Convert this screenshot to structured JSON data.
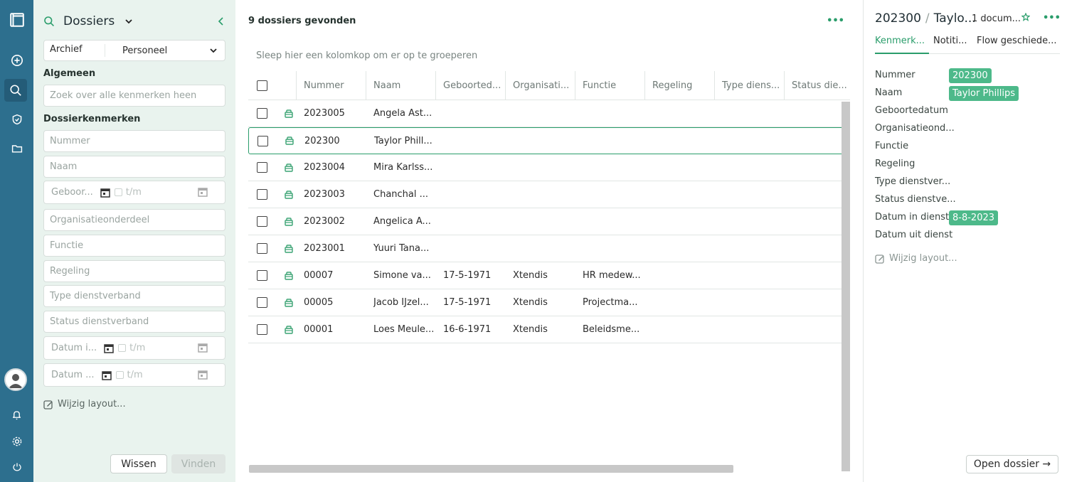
{
  "rail": {
    "icons": [
      "layout-icon",
      "add-icon",
      "search-icon",
      "shield-icon",
      "folder-icon",
      "avatar",
      "bell-icon",
      "gear-icon",
      "power-icon"
    ]
  },
  "search": {
    "title": "Dossiers",
    "archief_label": "Archief",
    "archief_value": "Personeel",
    "section_general": "Algemeen",
    "search_all_placeholder": "Zoek over alle kenmerken heen",
    "section_dossier": "Dossierkenmerken",
    "fields": {
      "nummer": "Nummer",
      "naam": "Naam",
      "geboorte": "Geboor...",
      "org": "Organisatieonderdeel",
      "functie": "Functie",
      "regeling": "Regeling",
      "type": "Type dienstverband",
      "status": "Status dienstverband",
      "datum_in": "Datum i...",
      "datum_uit": "Datum ...",
      "tm": "t/m"
    },
    "wijzig": "Wijzig layout...",
    "wissen": "Wissen",
    "vinden": "Vinden"
  },
  "main": {
    "count": "9 dossiers gevonden",
    "more": "•••",
    "hint": "Sleep hier een kolomkop om er op te groeperen",
    "columns": [
      "Nummer",
      "Naam",
      "Geboorted...",
      "Organisati...",
      "Functie",
      "Regeling",
      "Type diens...",
      "Status die..."
    ],
    "rows": [
      {
        "nummer": "2023005",
        "naam": "Angela Ast...",
        "geb": "",
        "org": "",
        "functie": ""
      },
      {
        "nummer": "202300",
        "naam": "Taylor Phill...",
        "geb": "",
        "org": "",
        "functie": ""
      },
      {
        "nummer": "2023004",
        "naam": "Mira Karlss...",
        "geb": "",
        "org": "",
        "functie": ""
      },
      {
        "nummer": "2023003",
        "naam": "Chanchal ...",
        "geb": "",
        "org": "",
        "functie": ""
      },
      {
        "nummer": "2023002",
        "naam": "Angelica A...",
        "geb": "",
        "org": "",
        "functie": ""
      },
      {
        "nummer": "2023001",
        "naam": "Yuuri Tana...",
        "geb": "",
        "org": "",
        "functie": ""
      },
      {
        "nummer": "00007",
        "naam": "Simone va...",
        "geb": "17-5-1971",
        "org": "Xtendis",
        "functie": "HR medew..."
      },
      {
        "nummer": "00005",
        "naam": "Jacob IJzel...",
        "geb": "17-5-1971",
        "org": "Xtendis",
        "functie": "Projectma..."
      },
      {
        "nummer": "00001",
        "naam": "Loes Meule...",
        "geb": "16-6-1971",
        "org": "Xtendis",
        "functie": "Beleidsme..."
      }
    ]
  },
  "detail": {
    "number": "202300",
    "name": "Taylo...",
    "docs": "1 docum...",
    "more": "•••",
    "tabs": [
      "Kenmerk...",
      "Notiti...",
      "Flow geschiede..."
    ],
    "props": {
      "nummer_label": "Nummer",
      "nummer_value": "202300",
      "naam_label": "Naam",
      "naam_value": "Taylor Phillips",
      "geboorte_label": "Geboortedatum",
      "org_label": "Organisatieond...",
      "functie_label": "Functie",
      "regeling_label": "Regeling",
      "type_label": "Type dienstver...",
      "status_label": "Status dienstve...",
      "datum_in_label": "Datum in dienst",
      "datum_in_value": "8-8-2023",
      "datum_uit_label": "Datum uit dienst"
    },
    "wijzig": "Wijzig layout...",
    "open": "Open dossier →"
  },
  "colors": {
    "rail": "#2d6f8e",
    "panel": "#e9f3ee",
    "accent": "#2a9d6b",
    "badge": "#4db98a"
  }
}
